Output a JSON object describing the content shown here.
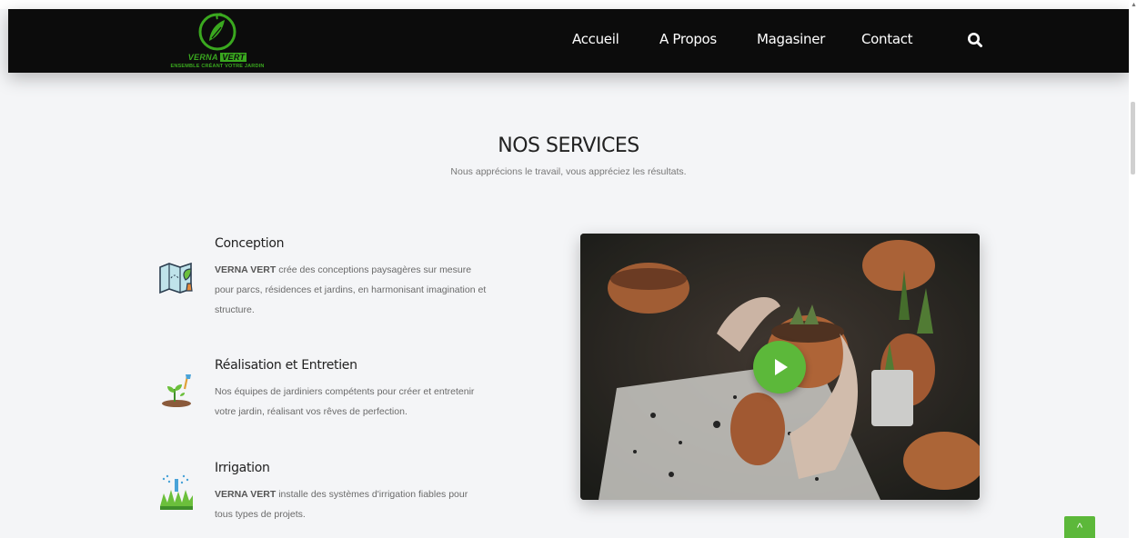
{
  "header": {
    "logo": {
      "brand_prefix": "VERNA",
      "brand_highlight": "VERT",
      "tagline": "ENSEMBLE CRÉANT VOTRE JARDIN"
    },
    "nav": [
      {
        "label": "Accueil"
      },
      {
        "label": "A Propos"
      },
      {
        "label": "Magasiner"
      },
      {
        "label": "Contact"
      }
    ],
    "search_icon": "search-icon"
  },
  "services_section": {
    "title": "NOS SERVICES",
    "subtitle": "Nous apprécions le travail, vous appréciez les résultats.",
    "items": [
      {
        "title": "Conception",
        "brand": "VERNA VERT",
        "text": " crée des conceptions paysagères sur mesure pour parcs, résidences et jardins, en harmonisant imagination et structure.",
        "icon": "blueprint-plant-icon"
      },
      {
        "title": "Réalisation et Entretien",
        "brand": "",
        "text": "Nos équipes de jardiniers compétents pour créer et entretenir votre jardin, réalisant vos rêves de perfection.",
        "icon": "sprout-shovel-icon"
      },
      {
        "title": "Irrigation",
        "brand": "VERNA VERT",
        "text": " installe des systèmes d'irrigation fiables pour tous types de projets.",
        "icon": "sprinkler-grass-icon"
      }
    ],
    "video": {
      "play_icon": "play-icon"
    }
  },
  "back_to_top": {
    "icon": "chevron-up-icon",
    "glyph": "^"
  },
  "colors": {
    "accent_green": "#5cb83a",
    "navbar": "#0c0c0c",
    "background": "#f4f5f7"
  }
}
